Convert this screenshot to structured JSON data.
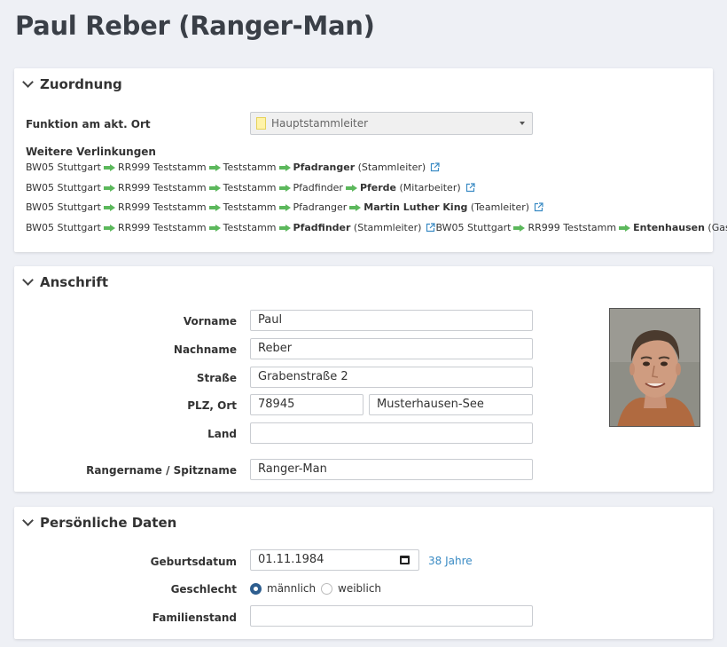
{
  "page_title": "Paul Reber (Ranger-Man)",
  "zuordnung": {
    "header": "Zuordnung",
    "funktion_label": "Funktion am akt. Ort",
    "funktion_value": "Hauptstammleiter",
    "weitere_label": "Weitere Verlinkungen",
    "rows": [
      [
        {
          "t": "BW05 Stuttgart",
          "b": false
        },
        {
          "t": "RR999 Teststamm",
          "b": false
        },
        {
          "t": "Teststamm",
          "b": false
        },
        {
          "t": "Pfadranger",
          "b": true,
          "suffix": " (Stammleiter)"
        }
      ],
      [
        {
          "t": "BW05 Stuttgart",
          "b": false
        },
        {
          "t": "RR999 Teststamm",
          "b": false
        },
        {
          "t": "Teststamm",
          "b": false
        },
        {
          "t": "Pfadfinder",
          "b": false
        },
        {
          "t": "Pferde",
          "b": true,
          "suffix": " (Mitarbeiter)"
        }
      ],
      [
        {
          "t": "BW05 Stuttgart",
          "b": false
        },
        {
          "t": "RR999 Teststamm",
          "b": false
        },
        {
          "t": "Teststamm",
          "b": false
        },
        {
          "t": "Pfadranger",
          "b": false
        },
        {
          "t": "Martin Luther King",
          "b": true,
          "suffix": " (Teamleiter)"
        }
      ],
      [
        {
          "t": "BW05 Stuttgart",
          "b": false
        },
        {
          "t": "RR999 Teststamm",
          "b": false
        },
        {
          "t": "Teststamm",
          "b": false
        },
        {
          "t": "Pfadfinder",
          "b": true,
          "suffix": " (Stammleiter)",
          "ext": true,
          "noarrow": true
        },
        {
          "t": "BW05 Stuttgart",
          "b": false
        },
        {
          "t": "RR999 Teststamm",
          "b": false
        },
        {
          "t": "Entenhausen",
          "b": true,
          "suffix": " (Gast)"
        }
      ]
    ]
  },
  "anschrift": {
    "header": "Anschrift",
    "vorname_label": "Vorname",
    "vorname": "Paul",
    "nachname_label": "Nachname",
    "nachname": "Reber",
    "strasse_label": "Straße",
    "strasse": "Grabenstraße 2",
    "plzort_label": "PLZ, Ort",
    "plz": "78945",
    "ort": "Musterhausen-See",
    "land_label": "Land",
    "land": "",
    "rangername_label": "Rangername / Spitzname",
    "rangername": "Ranger-Man"
  },
  "persoenlich": {
    "header": "Persönliche Daten",
    "geburtsdatum_label": "Geburtsdatum",
    "geburtsdatum": "01.11.1984",
    "alter": "38 Jahre",
    "geschlecht_label": "Geschlecht",
    "geschlecht_options": [
      "männlich",
      "weiblich"
    ],
    "geschlecht_selected": "männlich",
    "familienstand_label": "Familienstand",
    "familienstand": ""
  },
  "colors": {
    "arrow": "#5cb85c",
    "link": "#3a8bc4",
    "radio": "#2e5e8f"
  }
}
